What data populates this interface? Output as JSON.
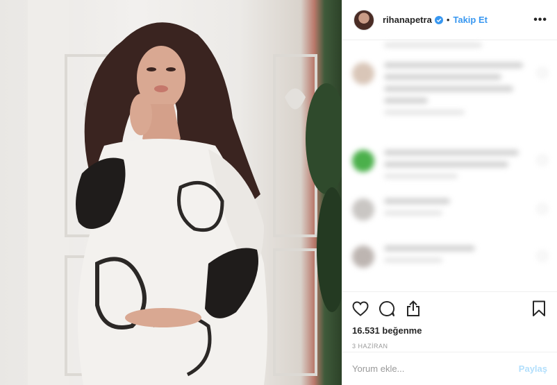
{
  "photo": {
    "icon": "post-photo",
    "description_icon": "woman-in-white-robe-photo"
  },
  "header": {
    "username": "rihanapetra",
    "separator": "•",
    "follow_label": "Takip Et",
    "more_label": "•••"
  },
  "actions": {
    "likes_text": "16.531 beğenme",
    "date_text": "3 HAZİRAN"
  },
  "comment_box": {
    "placeholder": "Yorum ekle...",
    "post_label": "Paylaş"
  },
  "colors": {
    "accent": "#3897f0",
    "post_disabled": "#b2dffc",
    "border": "#efefef",
    "text": "#262626",
    "muted": "#999999"
  },
  "icons": [
    "heart-icon",
    "comment-icon",
    "share-icon",
    "bookmark-icon",
    "verified-badge-icon",
    "more-options-icon"
  ]
}
